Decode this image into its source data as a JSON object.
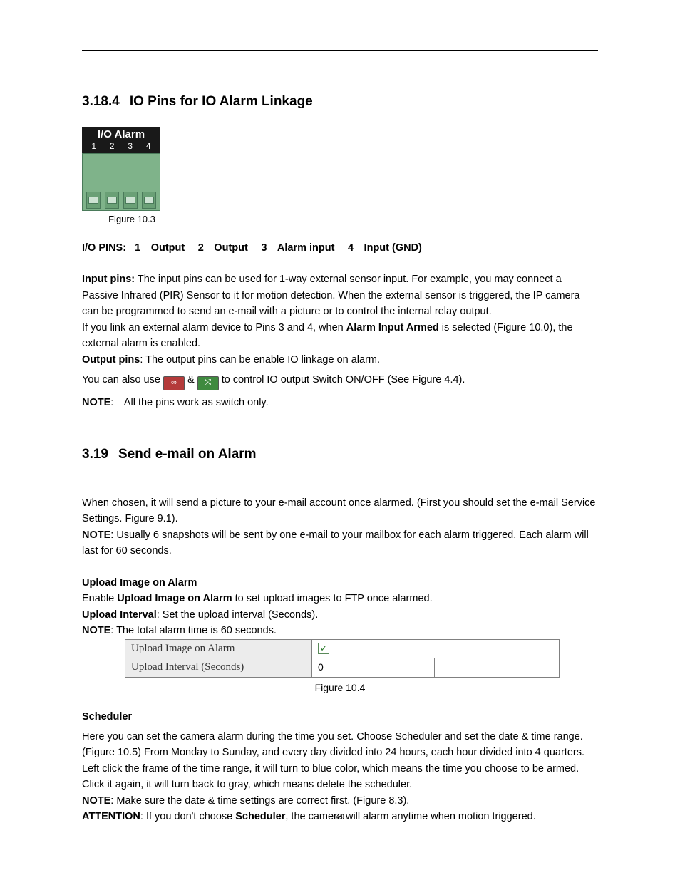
{
  "section1": {
    "number": "3.18.4",
    "title": "IO Pins for IO Alarm Linkage"
  },
  "fig10_3": {
    "header": "I/O Alarm",
    "nums": [
      "1",
      "2",
      "3",
      "4"
    ],
    "caption": "Figure 10.3"
  },
  "io_pins_line": {
    "label": "I/O PINS:",
    "items": "1 Output  2 Output  3 Alarm input  4 Input (GND)"
  },
  "p_input_lead": "Input pins:",
  "p_input_rest": " The input pins can be used for 1-way external sensor input. For example, you may connect a Passive Infrared (PIR) Sensor to it for motion detection. When the external sensor is triggered, the IP camera can be programmed to send an e-mail with a picture or to control the internal relay output.",
  "p_link_pre": "If you link an external alarm device to Pins 3 and 4, when ",
  "p_link_bold": "Alarm Input Armed",
  "p_link_post": " is selected (Figure 10.0), the external alarm is enabled.",
  "p_output_lead": "Output pins",
  "p_output_rest": ": The output pins can be enable IO linkage on alarm.",
  "p_use_pre": "You can also use  ",
  "p_use_amp": "  &  ",
  "p_use_post": "  to control IO output Switch ON/OFF (See Figure 4.4).",
  "note1_lead": "NOTE",
  "note1_rest": ": All the pins work as switch only.",
  "section2": {
    "number": "3.19",
    "title": "Send e-mail on Alarm"
  },
  "p_email": "When chosen, it will send a picture to your e-mail account once alarmed. (First you should set the e-mail Service Settings. Figure 9.1).",
  "note2_lead": "NOTE",
  "note2_rest": ": Usually 6 snapshots will be sent by one e-mail to your mailbox for each alarm triggered. Each alarm will last for 60 seconds.",
  "upload_heading": "Upload Image on Alarm",
  "upload_enable_pre": "Enable ",
  "upload_enable_bold": "Upload Image on Alarm",
  "upload_enable_post": " to set upload images to FTP once alarmed.",
  "upload_interval_lead": "Upload Interval",
  "upload_interval_rest": ": Set the upload interval (Seconds).",
  "note3_lead": "NOTE",
  "note3_rest": ": The total alarm time is 60 seconds.",
  "table": {
    "row1_label": "Upload Image on Alarm",
    "row1_checked": true,
    "row2_label": "Upload Interval (Seconds)",
    "row2_value": "0"
  },
  "fig10_4_caption": "Figure 10.4",
  "scheduler_heading": "Scheduler",
  "scheduler_p1": "Here you can set the camera alarm during the time you set. Choose Scheduler and set the date & time range. (Figure 10.5) From Monday to Sunday, and every day divided into 24 hours, each hour divided into 4 quarters. Left click the frame of the time range, it will turn to blue color, which means the time you choose to be armed. Click it again, it will turn back to gray, which means delete the scheduler.",
  "note4_lead": "NOTE",
  "note4_rest": ": Make sure the date & time settings are correct first. (Figure 8.3).",
  "attention_lead": "ATTENTION",
  "attention_mid1": ": If you don't choose ",
  "attention_bold": "Scheduler",
  "attention_mid2": ", the camera will alarm anytime when motion triggered.",
  "page_number": "49",
  "icon_on_glyph": "∞",
  "icon_off_glyph": "⤭"
}
